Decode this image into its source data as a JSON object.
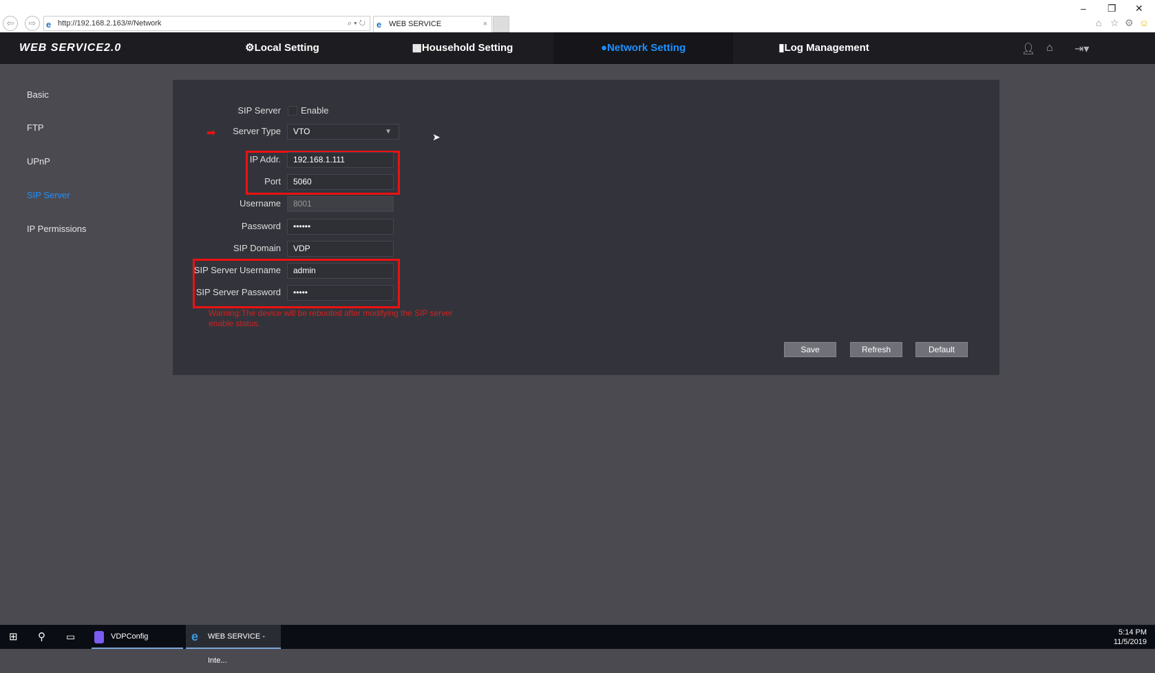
{
  "browser": {
    "url": "http://192.168.2.163/#/Network",
    "tab_title": "WEB SERVICE",
    "window_controls": [
      "minimize",
      "restore",
      "close"
    ],
    "toolbar_icons": [
      "home-icon",
      "star-icon",
      "gear-icon",
      "smiley-icon"
    ]
  },
  "nav": {
    "logo": "WEB SERVICE2.0",
    "items": [
      {
        "label": "Local Setting",
        "icon": "gear-icon"
      },
      {
        "label": "Household Setting",
        "icon": "building-icon"
      },
      {
        "label": "Network Setting",
        "icon": "globe-icon",
        "active": true
      },
      {
        "label": "Log Management",
        "icon": "notebook-icon"
      }
    ],
    "right_icons": [
      "user-icon",
      "home-icon",
      "logout-icon"
    ],
    "active_color": "#1e90ff"
  },
  "sidebar": {
    "items": [
      {
        "label": "Basic"
      },
      {
        "label": "FTP"
      },
      {
        "label": "UPnP"
      },
      {
        "label": "SIP Server",
        "active": true
      },
      {
        "label": "IP Permissions"
      }
    ]
  },
  "form": {
    "sip_server_label": "SIP Server",
    "enable_label": "Enable",
    "enable_checked": false,
    "server_type_label": "Server Type",
    "server_type_value": "VTO",
    "ip_label": "IP Addr.",
    "ip_value": "192.168.1.111",
    "port_label": "Port",
    "port_value": "5060",
    "username_label": "Username",
    "username_value": "8001",
    "password_label": "Password",
    "password_value": "••••••",
    "domain_label": "SIP Domain",
    "domain_value": "VDP",
    "sip_user_label": "SIP Server Username",
    "sip_user_value": "admin",
    "sip_pass_label": "SIP Server Password",
    "sip_pass_value": "•••••",
    "warning": "Warning:The device will be rebooted after modifying the SIP server enable status."
  },
  "buttons": {
    "save": "Save",
    "refresh": "Refresh",
    "default": "Default"
  },
  "taskbar": {
    "apps": [
      {
        "label": "VDPConfig"
      },
      {
        "label": "WEB SERVICE - Inte..."
      }
    ],
    "time": "5:14 PM",
    "date": "11/5/2019"
  }
}
